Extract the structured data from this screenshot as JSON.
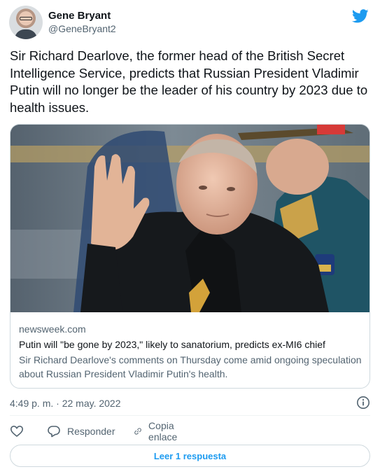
{
  "author": {
    "display_name": "Gene Bryant",
    "handle": "@GeneBryant2"
  },
  "tweet": {
    "text": "Sir Richard Dearlove, the former head of the British Secret Intelligence Service, predicts that Russian President Vladimir Putin will no longer be the leader of his country by 2023 due to health issues."
  },
  "card": {
    "domain": "newsweek.com",
    "title": "Putin will \"be gone by 2023,\" likely to sanatorium, predicts ex-MI6 chief",
    "description": "Sir Richard Dearlove's comments on Thursday come amid ongoing speculation about Russian President Vladimir Putin's health."
  },
  "meta": {
    "timestamp": "4:49 p. m. · 22 may. 2022"
  },
  "actions": {
    "like_icon": "heart-icon",
    "reply_label": "Responder",
    "copy_link_label": "Copia enlace"
  },
  "read_replies_label": "Leer 1 respuesta",
  "colors": {
    "twitter_blue": "#1d9bf0",
    "text_primary": "#0f1419",
    "text_secondary": "#536471",
    "border": "#cfd9de"
  }
}
